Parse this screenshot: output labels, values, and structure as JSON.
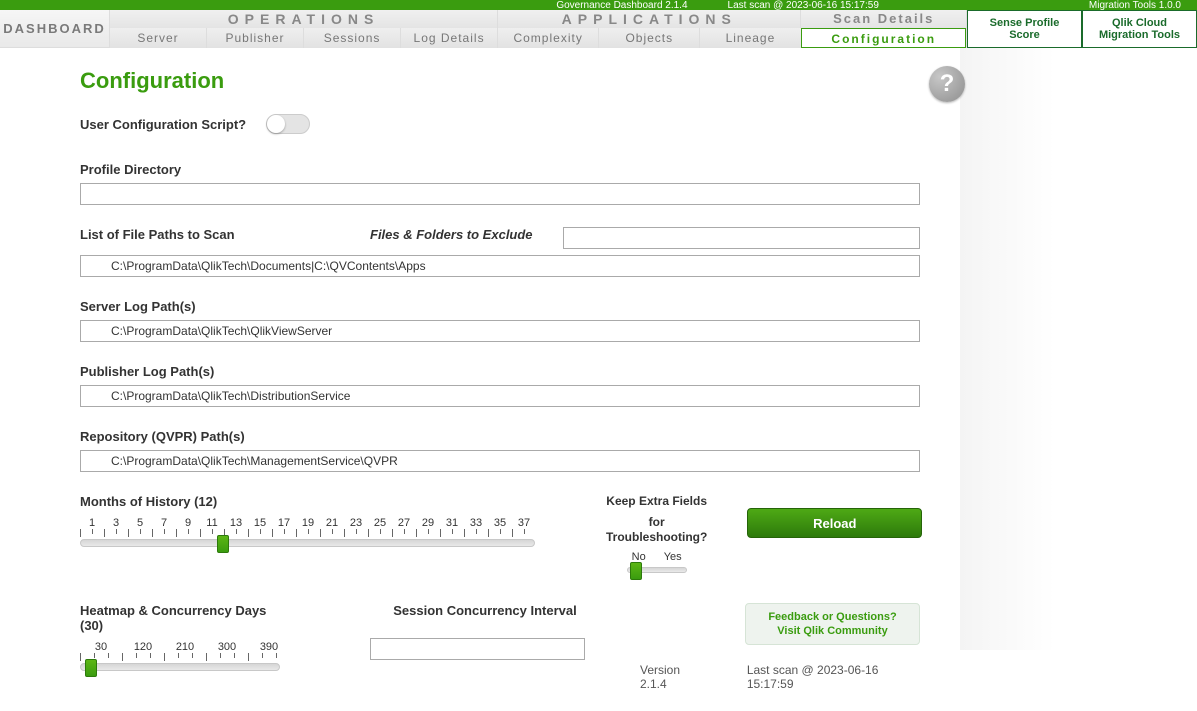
{
  "topstrip": {
    "app": "Governance Dashboard 2.1.4",
    "lastscan": "Last scan @ 2023-06-16 15:17:59",
    "tools": "Migration Tools 1.0.0"
  },
  "header": {
    "dashboard": "DASHBOARD",
    "ops_title": "OPERATIONS",
    "ops_tabs": [
      "Server",
      "Publisher",
      "Sessions",
      "Log Details"
    ],
    "apps_title": "APPLICATIONS",
    "apps_tabs": [
      "Complexity",
      "Objects",
      "Lineage"
    ],
    "scan_title": "Scan Details",
    "scan_tab": "Configuration",
    "right1a": "Sense Profile",
    "right1b": "Score",
    "right2a": "Qlik Cloud",
    "right2b": "Migration Tools"
  },
  "page": {
    "title": "Configuration",
    "ucs_label": "User Configuration Script?",
    "profile_dir_label": "Profile Directory",
    "profile_dir_value": "",
    "list_paths_label": "List of File Paths to Scan",
    "exclude_label": "Files & Folders to Exclude",
    "exclude_value": "",
    "list_paths_value": "C:\\ProgramData\\QlikTech\\Documents|C:\\QVContents\\Apps",
    "server_log_label": "Server Log Path(s)",
    "server_log_value": "C:\\ProgramData\\QlikTech\\QlikViewServer",
    "pub_log_label": "Publisher Log Path(s)",
    "pub_log_value": "C:\\ProgramData\\QlikTech\\DistributionService",
    "qvpr_label": "Repository (QVPR) Path(s)",
    "qvpr_value": "C:\\ProgramData\\QlikTech\\ManagementService\\QVPR",
    "months_label": "Months of History (12)",
    "months_value": 12,
    "months_ticks": [
      "1",
      "3",
      "5",
      "7",
      "9",
      "11",
      "13",
      "15",
      "17",
      "19",
      "21",
      "23",
      "25",
      "27",
      "29",
      "31",
      "33",
      "35",
      "37"
    ],
    "keep_label1": "Keep Extra Fields",
    "keep_label2": "for Troubleshooting?",
    "keep_no": "No",
    "keep_yes": "Yes",
    "keep_value": "No",
    "reload": "Reload",
    "heatmap_label": "Heatmap & Concurrency Days (30)",
    "heatmap_value": 30,
    "heatmap_ticks": [
      "30",
      "120",
      "210",
      "300",
      "390"
    ],
    "sci_label": "Session Concurrency Interval",
    "sci_value": "",
    "feedback1": "Feedback or Questions?",
    "feedback2": "Visit Qlik Community",
    "version": "Version 2.1.4",
    "lastscan": "Last scan @ 2023-06-16 15:17:59"
  }
}
